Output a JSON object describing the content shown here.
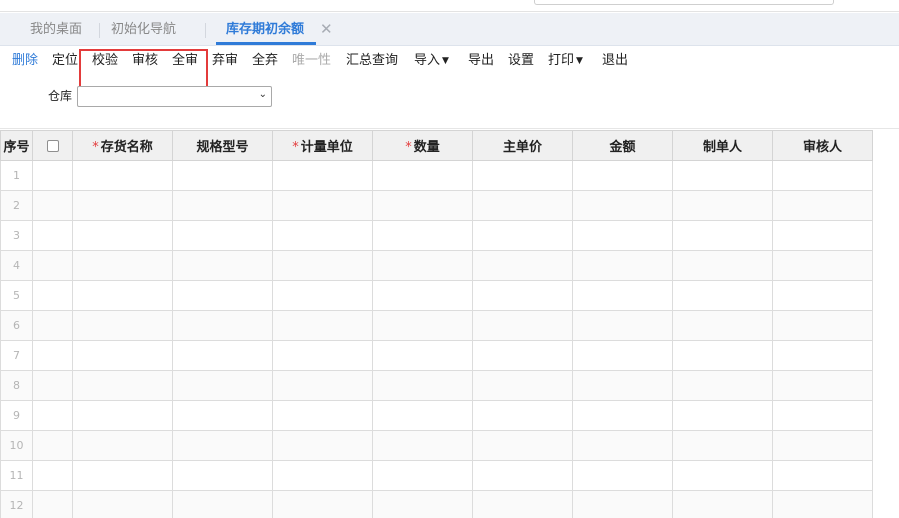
{
  "tabs": [
    {
      "label": "我的桌面",
      "active": false
    },
    {
      "label": "初始化导航",
      "active": false
    },
    {
      "label": "库存期初余额",
      "active": true
    }
  ],
  "tab_close_glyph": "✕",
  "toolbar": {
    "delete": "删除",
    "locate": "定位",
    "verify": "校验",
    "audit": "审核",
    "audit_all": "全审",
    "unaudit": "弃审",
    "unaudit_all": "全弃",
    "uniqueness": "唯一性",
    "summary_query": "汇总查询",
    "import": "导入",
    "export": "导出",
    "settings": "设置",
    "print": "打印",
    "exit": "退出"
  },
  "filter": {
    "warehouse_label": "仓库",
    "warehouse_value": ""
  },
  "table": {
    "columns": [
      {
        "label": "序号",
        "required": false
      },
      {
        "label": "",
        "required": false,
        "checkbox": true
      },
      {
        "label": "存货名称",
        "required": true
      },
      {
        "label": "规格型号",
        "required": false
      },
      {
        "label": "计量单位",
        "required": true
      },
      {
        "label": "数量",
        "required": true
      },
      {
        "label": "主单价",
        "required": false
      },
      {
        "label": "金额",
        "required": false
      },
      {
        "label": "制单人",
        "required": false
      },
      {
        "label": "审核人",
        "required": false
      }
    ],
    "required_mark": "*",
    "row_numbers": [
      "1",
      "2",
      "3",
      "4",
      "5",
      "6",
      "7",
      "8",
      "9",
      "10",
      "11",
      "12"
    ]
  },
  "colors": {
    "accent": "#2f7bd8",
    "highlight": "#e33b3b"
  }
}
